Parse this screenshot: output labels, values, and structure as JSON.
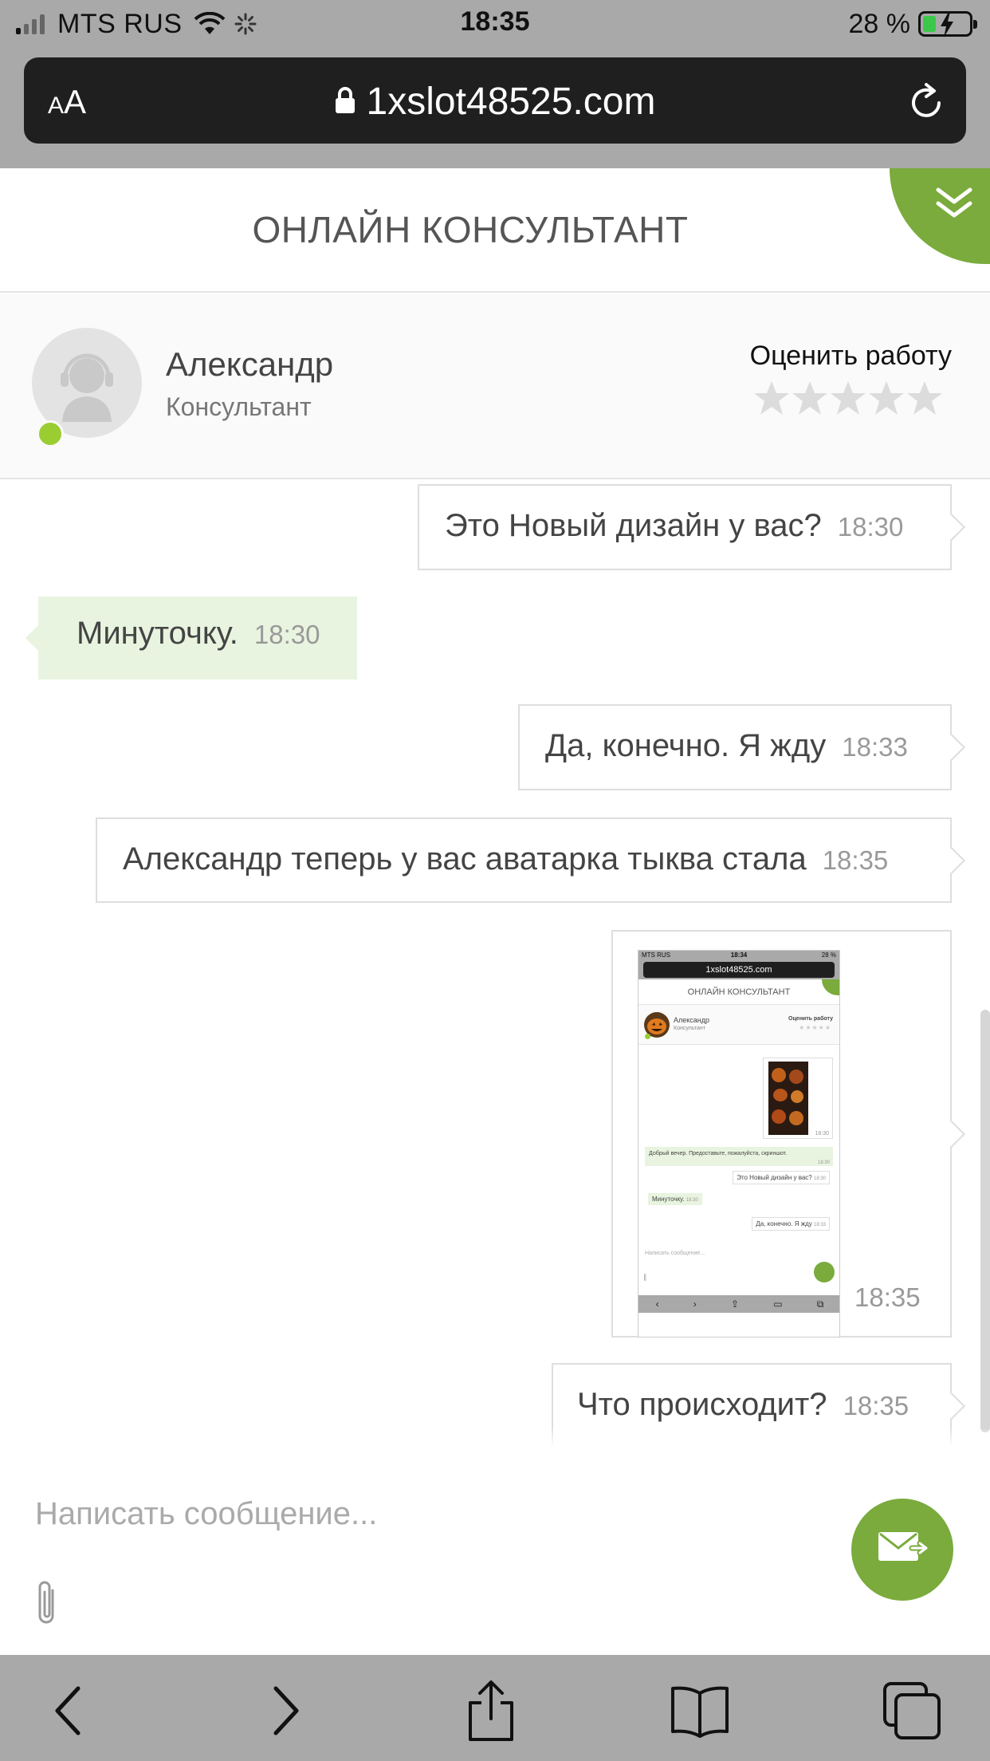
{
  "status_bar": {
    "carrier": "MTS RUS",
    "time": "18:35",
    "battery": "28 %",
    "battery_level": 0.28
  },
  "browser": {
    "text_size_label": "AA",
    "url": "1xslot48525.com"
  },
  "chat": {
    "title": "ОНЛАЙН КОНСУЛЬТАНТ",
    "consultant": {
      "name": "Александр",
      "role": "Консультант",
      "status": "online"
    },
    "rating": {
      "label": "Оценить работу",
      "max": 5,
      "value": 0
    },
    "messages": [
      {
        "direction": "out",
        "text": "Это Новый дизайн у вас?",
        "time": "18:30"
      },
      {
        "direction": "in",
        "text": "Минуточку.",
        "time": "18:30"
      },
      {
        "direction": "out",
        "text": "Да, конечно. Я жду",
        "time": "18:33"
      },
      {
        "direction": "out",
        "text": "Александр теперь у вас аватарка тыква стала",
        "time": "18:35"
      },
      {
        "direction": "out",
        "type": "image",
        "time": "18:35"
      },
      {
        "direction": "out",
        "text": "Что происходит?",
        "time": "18:35"
      }
    ],
    "attachment_screenshot": {
      "carrier": "MTS RUS",
      "time": "18:34",
      "battery": "28 %",
      "url": "1xslot48525.com",
      "title": "ОНЛАЙН КОНСУЛЬТАНТ",
      "name": "Александр",
      "role": "Консультант",
      "rate_label": "Оценить работу",
      "image_time": "18:30",
      "greeting": "Добрый вечер. Предоставьте, пожалуйста, скриншот.",
      "greeting_time": "18:30",
      "msg1": "Это Новый дизайн у вас?",
      "msg1_time": "18:30",
      "msg2": "Минуточку.",
      "msg2_time": "18:30",
      "msg3": "Да, конечно. Я жду",
      "msg3_time": "18:33",
      "placeholder": "Написать сообщение..."
    }
  },
  "composer": {
    "placeholder": "Написать сообщение..."
  },
  "colors": {
    "accent": "#7aab3c",
    "incoming_bubble": "#e8f4df",
    "online": "#9acd32",
    "chrome": "#a9a9a9"
  }
}
